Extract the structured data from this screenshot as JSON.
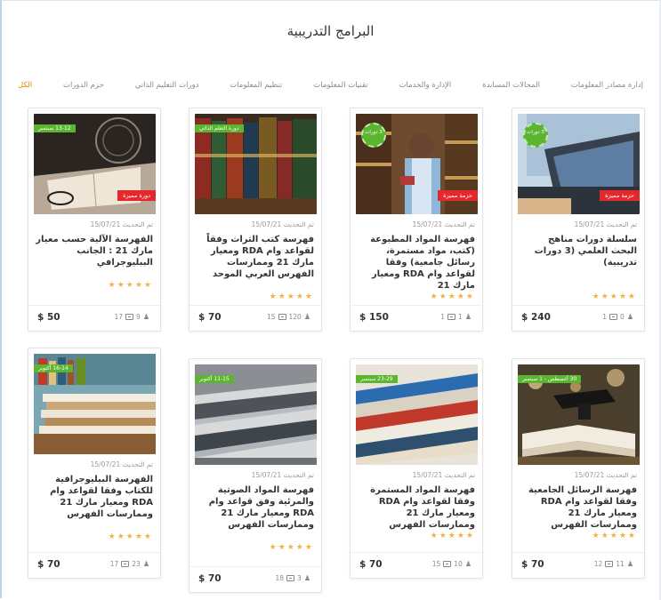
{
  "page": {
    "title": "البرامج التدريبية"
  },
  "tabs": [
    {
      "label": "الكل",
      "active": true
    },
    {
      "label": "حزم الدورات",
      "active": false
    },
    {
      "label": "دورات التعليم الذاتي",
      "active": false
    },
    {
      "label": "تنظيم المعلومات",
      "active": false
    },
    {
      "label": "تقنيات المعلومات",
      "active": false
    },
    {
      "label": "الإدارة والخدمات",
      "active": false
    },
    {
      "label": "المجالات المساندة",
      "active": false
    },
    {
      "label": "إدارة مصادر المعلومات",
      "active": false
    }
  ],
  "colors": {
    "accent": "#e28a00",
    "green": "#5bb531",
    "red": "#e4282b",
    "star": "#f1b24a"
  },
  "cards": [
    {
      "updated": "تم التحديث 15/07/21",
      "title": "سلسلة دورات مناهج البحث العلمي (3 دورات تدريبية)",
      "stars": "★★★★★",
      "price": "$ 240",
      "lessons": "1",
      "students": "0",
      "badge": "حزمة مميزة",
      "seal": "3 دورات",
      "ribbon": ""
    },
    {
      "updated": "تم التحديث 15/07/21",
      "title": "فهرسة المواد المطبوعة (كتب، مواد مستمرة، رسائل جامعية) وفقا لقواعد وام RDA ومعيار مارك 21",
      "stars": "★★★★★",
      "price": "$ 150",
      "lessons": "1",
      "students": "1",
      "badge": "حزمة مميزة",
      "seal": "3 دورات",
      "ribbon": ""
    },
    {
      "updated": "تم التحديث 15/07/21",
      "title": "فهرسة كتب التراث وفقاً لقواعد وام RDA ومعيار مارك 21 وممارسات الفهرس العربي الموحد",
      "stars": "★★★★★",
      "price": "$ 70",
      "lessons": "15",
      "students": "120",
      "badge": "",
      "seal": "",
      "ribbon": "دورة التعلم الذاتي"
    },
    {
      "updated": "تم التحديث 15/07/21",
      "title": "الفهرسة الآلية حسب معيار مارك 21 : الجانب الببليوجرافي",
      "stars": "★★★★★",
      "price": "$ 50",
      "lessons": "17",
      "students": "9",
      "badge": "دورة مميزة",
      "seal": "",
      "ribbon": "13-12 سبتمبر"
    },
    {
      "updated": "تم التحديث 15/07/21",
      "title": "فهرسة الرسائل الجامعية وفقا لقواعد وام RDA ومعيار مارك 21 وممارسات الفهرس",
      "stars": "★★★★★",
      "price": "$ 70",
      "lessons": "12",
      "students": "11",
      "badge": "",
      "seal": "",
      "ribbon": "30 أغسطس - 1 سبتمبر"
    },
    {
      "updated": "تم التحديث 15/07/21",
      "title": "فهرسة المواد المستمرة وفقا لقواعد وام RDA ومعيار مارك 21 وممارسات الفهرس",
      "stars": "★★★★★",
      "price": "$ 70",
      "lessons": "15",
      "students": "10",
      "badge": "",
      "seal": "",
      "ribbon": "23-29 سبتمبر"
    },
    {
      "updated": "تم التحديث 15/07/21",
      "title": "فهرسة المواد الصوتية والمرئية وفق قواعد وام RDA ومعيار مارك 21 وممارسات الفهرس",
      "stars": "★★★★★",
      "price": "$ 70",
      "lessons": "18",
      "students": "3",
      "badge": "",
      "seal": "",
      "ribbon": "11-15 أكتوبر"
    },
    {
      "updated": "تم التحديث 15/07/21",
      "title": "الفهرسة الببليوجرافية للكتاب وفقا لقواعد وام RDA ومعيار مارك 21 وممارسات الفهرس",
      "stars": "★★★★★",
      "price": "$ 70",
      "lessons": "17",
      "students": "23",
      "badge": "",
      "seal": "",
      "ribbon": "16-14 أكتوبر"
    }
  ]
}
